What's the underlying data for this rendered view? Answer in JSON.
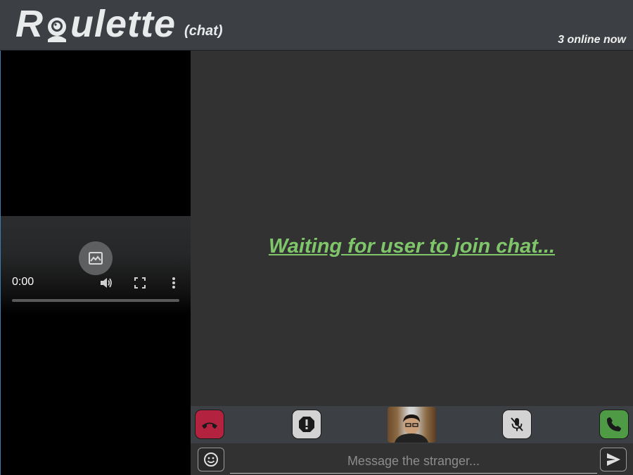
{
  "header": {
    "logo_prefix": "R",
    "logo_suffix": "ulette",
    "logo_sub": "(chat)",
    "online_status": "3 online now"
  },
  "video": {
    "time": "0:00",
    "progress": 0
  },
  "chat": {
    "waiting_message": "Waiting for user to join chat..."
  },
  "message_bar": {
    "placeholder": "Message the stranger..."
  },
  "colors": {
    "hangup": "#b3223f",
    "call": "#4e9a45",
    "waiting_text": "#7fc66b"
  },
  "icons": {
    "hangup": "phone-hangup-icon",
    "report": "exclamation-icon",
    "mute": "microphone-off-icon",
    "call": "phone-icon",
    "emoji": "smiley-icon",
    "send": "send-icon"
  }
}
